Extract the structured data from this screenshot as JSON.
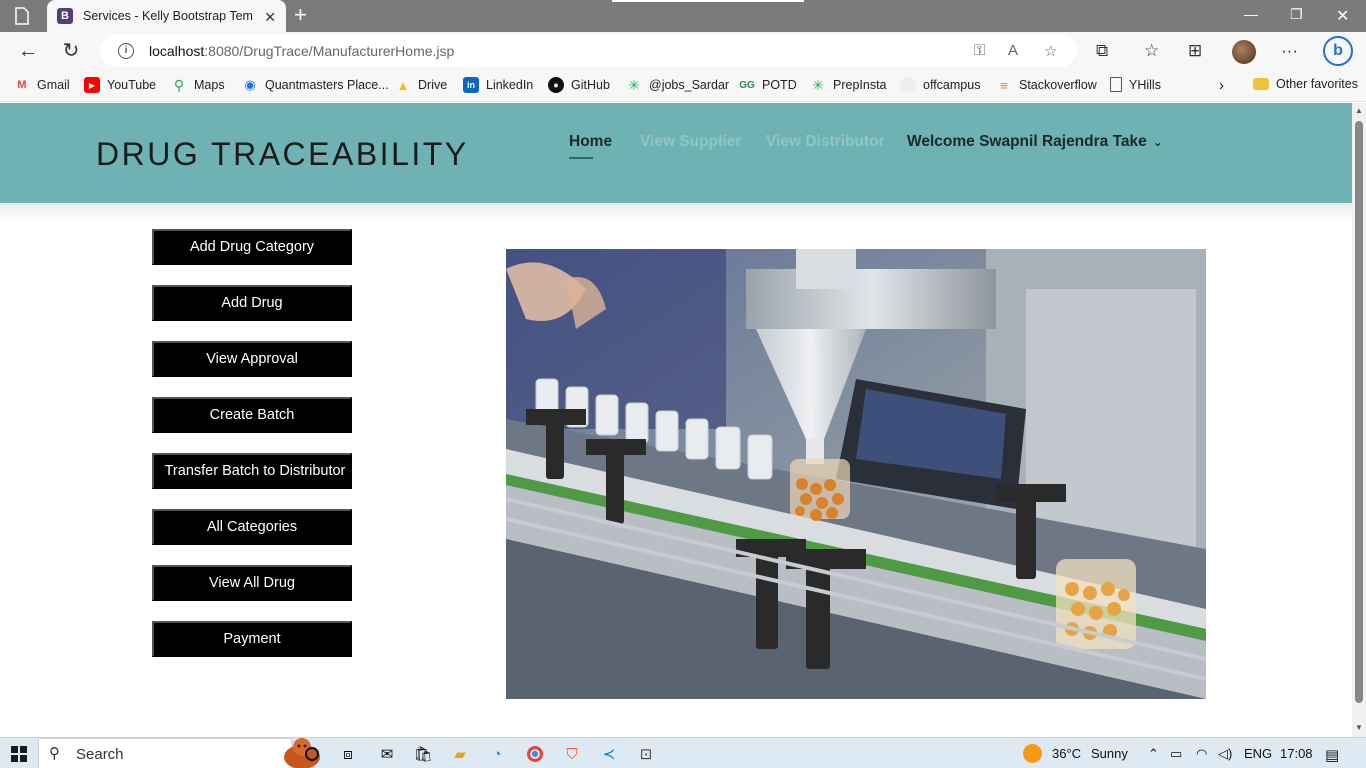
{
  "browser": {
    "tab_title": "Services - Kelly Bootstrap Template",
    "tab_favicon": "B",
    "url_host": "localhost",
    "url_path": ":8080/DrugTrace/ManufacturerHome.jsp",
    "bookmarks": [
      {
        "label": "Gmail",
        "icon": "gmail-icon",
        "color": "#ea4335"
      },
      {
        "label": "YouTube",
        "icon": "youtube-icon",
        "color": "#ff0000"
      },
      {
        "label": "Maps",
        "icon": "maps-icon",
        "color": "#34a853"
      },
      {
        "label": "Quantmasters Place...",
        "icon": "quantmasters-icon",
        "color": "#1a73e8"
      },
      {
        "label": "Drive",
        "icon": "drive-icon",
        "color": "#fbbc04"
      },
      {
        "label": "LinkedIn",
        "icon": "linkedin-icon",
        "color": "#0a66c2"
      },
      {
        "label": "GitHub",
        "icon": "github-icon",
        "color": "#111111"
      },
      {
        "label": "@jobs_Sardar",
        "icon": "perplexity-icon",
        "color": "#20b15a"
      },
      {
        "label": "POTD",
        "icon": "geeksforgeeks-icon",
        "color": "#2f8d46"
      },
      {
        "label": "PrepInsta",
        "icon": "prepinsta-icon",
        "color": "#20b15a"
      },
      {
        "label": "offcampus",
        "icon": "offcampus-icon",
        "color": "#dddddd"
      },
      {
        "label": "Stackoverflow",
        "icon": "stackoverflow-icon",
        "color": "#f48024"
      },
      {
        "label": "YHills",
        "icon": "page-icon",
        "color": "#555555"
      }
    ],
    "other_favorites": "Other favorites"
  },
  "site": {
    "brand": "DRUG TRACEABILITY",
    "nav": {
      "home": "Home",
      "view_supplier": "View Supplier",
      "view_distributor": "View Distributor",
      "welcome": "Welcome Swapnil Rajendra Take"
    },
    "menu": [
      "Add Drug Category",
      "Add Drug",
      "View Approval",
      "Create Batch",
      "Transfer Batch to Distributor",
      "All Categories",
      "View All Drug",
      "Payment"
    ]
  },
  "taskbar": {
    "search": "Search",
    "temperature": "36°C",
    "weather": "Sunny",
    "language": "ENG",
    "time": "17:08"
  },
  "colors": {
    "header_bg": "#6fb2b4",
    "button_bg": "#000000",
    "nav_muted": "#8fc6c7"
  }
}
